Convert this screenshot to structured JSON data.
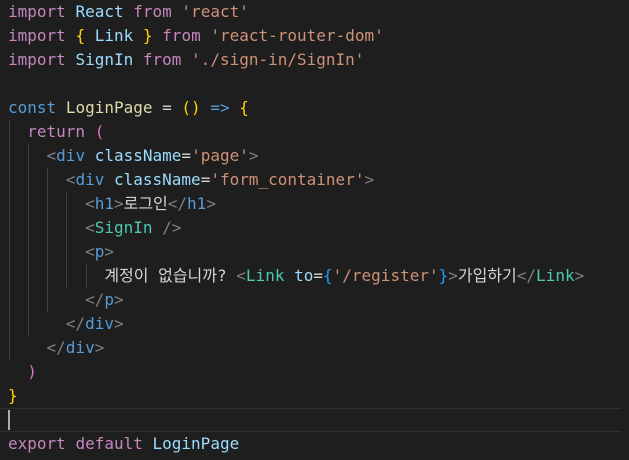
{
  "editor": {
    "theme_background": "#1e1e1e",
    "cursor_line": 17,
    "lines": [
      [
        {
          "t": "import",
          "c": "kw"
        },
        {
          "t": " ",
          "c": "text"
        },
        {
          "t": "React",
          "c": "var"
        },
        {
          "t": " ",
          "c": "text"
        },
        {
          "t": "from",
          "c": "kw"
        },
        {
          "t": " ",
          "c": "text"
        },
        {
          "t": "'react'",
          "c": "str"
        }
      ],
      [
        {
          "t": "import",
          "c": "kw"
        },
        {
          "t": " ",
          "c": "text"
        },
        {
          "t": "{",
          "c": "b1"
        },
        {
          "t": " ",
          "c": "text"
        },
        {
          "t": "Link",
          "c": "var"
        },
        {
          "t": " ",
          "c": "text"
        },
        {
          "t": "}",
          "c": "b1"
        },
        {
          "t": " ",
          "c": "text"
        },
        {
          "t": "from",
          "c": "kw"
        },
        {
          "t": " ",
          "c": "text"
        },
        {
          "t": "'react-router-dom'",
          "c": "str"
        }
      ],
      [
        {
          "t": "import",
          "c": "kw"
        },
        {
          "t": " ",
          "c": "text"
        },
        {
          "t": "SignIn",
          "c": "var"
        },
        {
          "t": " ",
          "c": "text"
        },
        {
          "t": "from",
          "c": "kw"
        },
        {
          "t": " ",
          "c": "text"
        },
        {
          "t": "'./sign-in/SignIn'",
          "c": "str"
        }
      ],
      [],
      [
        {
          "t": "const",
          "c": "decl"
        },
        {
          "t": " ",
          "c": "text"
        },
        {
          "t": "LoginPage",
          "c": "fn"
        },
        {
          "t": " = ",
          "c": "op"
        },
        {
          "t": "()",
          "c": "b1"
        },
        {
          "t": " ",
          "c": "text"
        },
        {
          "t": "=>",
          "c": "decl"
        },
        {
          "t": " ",
          "c": "text"
        },
        {
          "t": "{",
          "c": "b1"
        }
      ],
      [
        {
          "t": "  ",
          "c": "text"
        },
        {
          "t": "return",
          "c": "kw"
        },
        {
          "t": " ",
          "c": "text"
        },
        {
          "t": "(",
          "c": "b2"
        }
      ],
      [
        {
          "t": "    ",
          "c": "text"
        },
        {
          "t": "<",
          "c": "punct"
        },
        {
          "t": "div",
          "c": "decl"
        },
        {
          "t": " ",
          "c": "text"
        },
        {
          "t": "className",
          "c": "attr"
        },
        {
          "t": "=",
          "c": "text"
        },
        {
          "t": "'page'",
          "c": "str"
        },
        {
          "t": ">",
          "c": "punct"
        }
      ],
      [
        {
          "t": "      ",
          "c": "text"
        },
        {
          "t": "<",
          "c": "punct"
        },
        {
          "t": "div",
          "c": "decl"
        },
        {
          "t": " ",
          "c": "text"
        },
        {
          "t": "className",
          "c": "attr"
        },
        {
          "t": "=",
          "c": "text"
        },
        {
          "t": "'form_container'",
          "c": "str"
        },
        {
          "t": ">",
          "c": "punct"
        }
      ],
      [
        {
          "t": "        ",
          "c": "text"
        },
        {
          "t": "<",
          "c": "punct"
        },
        {
          "t": "h1",
          "c": "decl"
        },
        {
          "t": ">",
          "c": "punct"
        },
        {
          "t": "로그인",
          "c": "text"
        },
        {
          "t": "</",
          "c": "punct"
        },
        {
          "t": "h1",
          "c": "decl"
        },
        {
          "t": ">",
          "c": "punct"
        }
      ],
      [
        {
          "t": "        ",
          "c": "text"
        },
        {
          "t": "<",
          "c": "punct"
        },
        {
          "t": "SignIn",
          "c": "tag"
        },
        {
          "t": " ",
          "c": "text"
        },
        {
          "t": "/>",
          "c": "punct"
        }
      ],
      [
        {
          "t": "        ",
          "c": "text"
        },
        {
          "t": "<",
          "c": "punct"
        },
        {
          "t": "p",
          "c": "decl"
        },
        {
          "t": ">",
          "c": "punct"
        }
      ],
      [
        {
          "t": "          ",
          "c": "text"
        },
        {
          "t": "계정이 없습니까? ",
          "c": "text"
        },
        {
          "t": "<",
          "c": "punct"
        },
        {
          "t": "Link",
          "c": "tag"
        },
        {
          "t": " ",
          "c": "text"
        },
        {
          "t": "to",
          "c": "attr"
        },
        {
          "t": "=",
          "c": "text"
        },
        {
          "t": "{",
          "c": "b3"
        },
        {
          "t": "'/register'",
          "c": "str"
        },
        {
          "t": "}",
          "c": "b3"
        },
        {
          "t": ">",
          "c": "punct"
        },
        {
          "t": "가입하기",
          "c": "text"
        },
        {
          "t": "</",
          "c": "punct"
        },
        {
          "t": "Link",
          "c": "tag"
        },
        {
          "t": ">",
          "c": "punct"
        }
      ],
      [
        {
          "t": "        ",
          "c": "text"
        },
        {
          "t": "</",
          "c": "punct"
        },
        {
          "t": "p",
          "c": "decl"
        },
        {
          "t": ">",
          "c": "punct"
        }
      ],
      [
        {
          "t": "      ",
          "c": "text"
        },
        {
          "t": "</",
          "c": "punct"
        },
        {
          "t": "div",
          "c": "decl"
        },
        {
          "t": ">",
          "c": "punct"
        }
      ],
      [
        {
          "t": "    ",
          "c": "text"
        },
        {
          "t": "</",
          "c": "punct"
        },
        {
          "t": "div",
          "c": "decl"
        },
        {
          "t": ">",
          "c": "punct"
        }
      ],
      [
        {
          "t": "  ",
          "c": "text"
        },
        {
          "t": ")",
          "c": "b2"
        }
      ],
      [
        {
          "t": "}",
          "c": "b1"
        }
      ],
      [],
      [
        {
          "t": "export",
          "c": "kw"
        },
        {
          "t": " ",
          "c": "text"
        },
        {
          "t": "default",
          "c": "kw"
        },
        {
          "t": " ",
          "c": "text"
        },
        {
          "t": "LoginPage",
          "c": "var"
        }
      ]
    ]
  }
}
